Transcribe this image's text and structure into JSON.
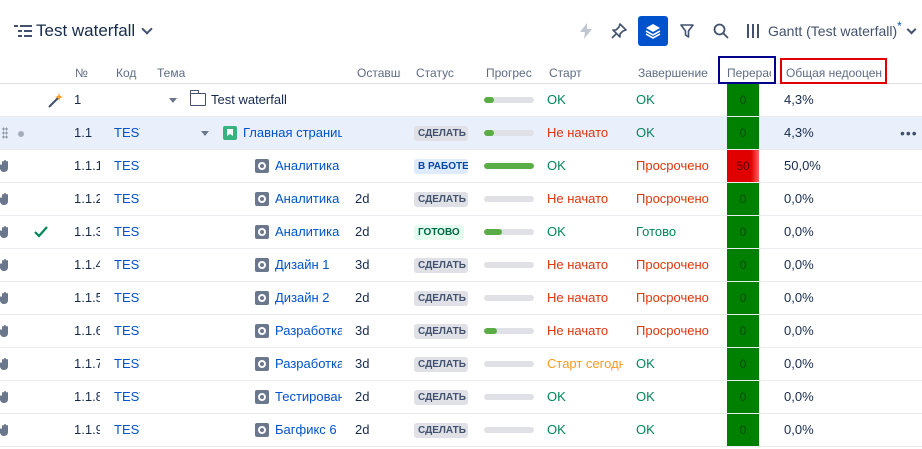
{
  "header": {
    "title": "Test waterfall",
    "gantt_label": "Gantt (Test waterfall)",
    "gantt_modified_mark": "*"
  },
  "columns": {
    "num": "№",
    "key": "Код",
    "summary": "Тема",
    "remaining": "Оставшееся",
    "status": "Статус",
    "progress": "Прогресс",
    "start": "Старт",
    "finish": "Завершение",
    "overdue": "Перерасход",
    "total_under": "Общая недооценка"
  },
  "rows": [
    {
      "num": "1",
      "key": "",
      "summary": "Test waterfall",
      "remaining": "",
      "status": "",
      "progress": 0.2,
      "start": "OK",
      "finish": "OK",
      "overdue": "0",
      "total": "4,3%"
    },
    {
      "num": "1.1",
      "key": "TEST",
      "summary": "Главная страница",
      "remaining": "",
      "status": "СДЕЛАТЬ",
      "progress": 0.2,
      "start": "Не начато",
      "finish": "OK",
      "overdue": "0",
      "total": "4,3%"
    },
    {
      "num": "1.1.1",
      "key": "TEST",
      "summary": "Аналитика",
      "remaining": "",
      "status": "В РАБОТЕ",
      "progress": 1.0,
      "start": "OK",
      "finish": "Просрочено",
      "overdue": "50",
      "total": "50,0%"
    },
    {
      "num": "1.1.2",
      "key": "TEST",
      "summary": "Аналитика",
      "remaining": "2d",
      "status": "СДЕЛАТЬ",
      "progress": 0,
      "start": "Не начато",
      "finish": "Просрочено",
      "overdue": "0",
      "total": "0,0%"
    },
    {
      "num": "1.1.3",
      "key": "TEST",
      "summary": "Аналитика",
      "remaining": "2d",
      "status": "ГОТОВО",
      "progress": 0.35,
      "start": "OK",
      "finish": "Готово",
      "overdue": "0",
      "total": "0,0%"
    },
    {
      "num": "1.1.4",
      "key": "TEST",
      "summary": "Дизайн 1",
      "remaining": "3d",
      "status": "СДЕЛАТЬ",
      "progress": 0,
      "start": "Не начато",
      "finish": "Просрочено",
      "overdue": "0",
      "total": "0,0%"
    },
    {
      "num": "1.1.5",
      "key": "TEST",
      "summary": "Дизайн 2",
      "remaining": "2d",
      "status": "СДЕЛАТЬ",
      "progress": 0,
      "start": "Не начато",
      "finish": "Просрочено",
      "overdue": "0",
      "total": "0,0%"
    },
    {
      "num": "1.1.6",
      "key": "TEST",
      "summary": "Разработка",
      "remaining": "3d",
      "status": "СДЕЛАТЬ",
      "progress": 0.25,
      "start": "Не начато",
      "finish": "Просрочено",
      "overdue": "0",
      "total": "0,0%"
    },
    {
      "num": "1.1.7",
      "key": "TEST",
      "summary": "Разработка",
      "remaining": "3d",
      "status": "СДЕЛАТЬ",
      "progress": 0,
      "start": "Старт сегодня",
      "finish": "OK",
      "overdue": "0",
      "total": "0,0%"
    },
    {
      "num": "1.1.8",
      "key": "TEST",
      "summary": "Тестирование",
      "remaining": "2d",
      "status": "СДЕЛАТЬ",
      "progress": 0,
      "start": "OK",
      "finish": "OK",
      "overdue": "0",
      "total": "0,0%"
    },
    {
      "num": "1.1.9",
      "key": "TEST",
      "summary": "Багфикс 6",
      "remaining": "2d",
      "status": "СДЕЛАТЬ",
      "progress": 0,
      "start": "OK",
      "finish": "OK",
      "overdue": "0",
      "total": "0,0%"
    }
  ],
  "colors": {
    "ok": "#00875a",
    "late": "#de350b",
    "today": "#ff991f",
    "overdue_ok": "#008000",
    "overdue_bad": "#e00000",
    "accent": "#0052cc"
  }
}
